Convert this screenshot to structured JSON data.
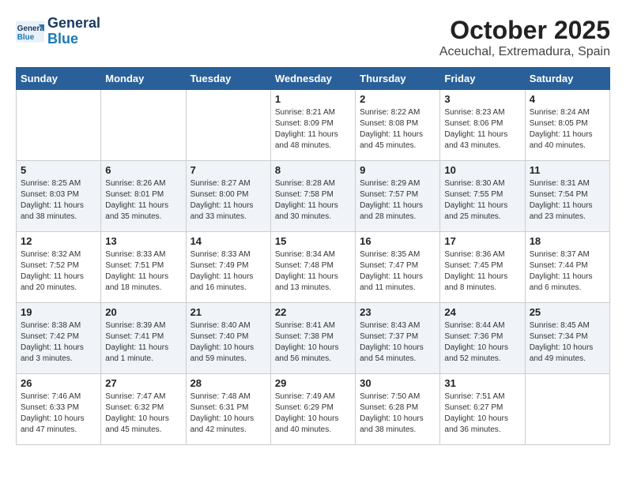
{
  "logo": {
    "line1": "General",
    "line2": "Blue"
  },
  "title": "October 2025",
  "subtitle": "Aceuchal, Extremadura, Spain",
  "headers": [
    "Sunday",
    "Monday",
    "Tuesday",
    "Wednesday",
    "Thursday",
    "Friday",
    "Saturday"
  ],
  "weeks": [
    [
      {
        "day": "",
        "info": ""
      },
      {
        "day": "",
        "info": ""
      },
      {
        "day": "",
        "info": ""
      },
      {
        "day": "1",
        "info": "Sunrise: 8:21 AM\nSunset: 8:09 PM\nDaylight: 11 hours and 48 minutes."
      },
      {
        "day": "2",
        "info": "Sunrise: 8:22 AM\nSunset: 8:08 PM\nDaylight: 11 hours and 45 minutes."
      },
      {
        "day": "3",
        "info": "Sunrise: 8:23 AM\nSunset: 8:06 PM\nDaylight: 11 hours and 43 minutes."
      },
      {
        "day": "4",
        "info": "Sunrise: 8:24 AM\nSunset: 8:05 PM\nDaylight: 11 hours and 40 minutes."
      }
    ],
    [
      {
        "day": "5",
        "info": "Sunrise: 8:25 AM\nSunset: 8:03 PM\nDaylight: 11 hours and 38 minutes."
      },
      {
        "day": "6",
        "info": "Sunrise: 8:26 AM\nSunset: 8:01 PM\nDaylight: 11 hours and 35 minutes."
      },
      {
        "day": "7",
        "info": "Sunrise: 8:27 AM\nSunset: 8:00 PM\nDaylight: 11 hours and 33 minutes."
      },
      {
        "day": "8",
        "info": "Sunrise: 8:28 AM\nSunset: 7:58 PM\nDaylight: 11 hours and 30 minutes."
      },
      {
        "day": "9",
        "info": "Sunrise: 8:29 AM\nSunset: 7:57 PM\nDaylight: 11 hours and 28 minutes."
      },
      {
        "day": "10",
        "info": "Sunrise: 8:30 AM\nSunset: 7:55 PM\nDaylight: 11 hours and 25 minutes."
      },
      {
        "day": "11",
        "info": "Sunrise: 8:31 AM\nSunset: 7:54 PM\nDaylight: 11 hours and 23 minutes."
      }
    ],
    [
      {
        "day": "12",
        "info": "Sunrise: 8:32 AM\nSunset: 7:52 PM\nDaylight: 11 hours and 20 minutes."
      },
      {
        "day": "13",
        "info": "Sunrise: 8:33 AM\nSunset: 7:51 PM\nDaylight: 11 hours and 18 minutes."
      },
      {
        "day": "14",
        "info": "Sunrise: 8:33 AM\nSunset: 7:49 PM\nDaylight: 11 hours and 16 minutes."
      },
      {
        "day": "15",
        "info": "Sunrise: 8:34 AM\nSunset: 7:48 PM\nDaylight: 11 hours and 13 minutes."
      },
      {
        "day": "16",
        "info": "Sunrise: 8:35 AM\nSunset: 7:47 PM\nDaylight: 11 hours and 11 minutes."
      },
      {
        "day": "17",
        "info": "Sunrise: 8:36 AM\nSunset: 7:45 PM\nDaylight: 11 hours and 8 minutes."
      },
      {
        "day": "18",
        "info": "Sunrise: 8:37 AM\nSunset: 7:44 PM\nDaylight: 11 hours and 6 minutes."
      }
    ],
    [
      {
        "day": "19",
        "info": "Sunrise: 8:38 AM\nSunset: 7:42 PM\nDaylight: 11 hours and 3 minutes."
      },
      {
        "day": "20",
        "info": "Sunrise: 8:39 AM\nSunset: 7:41 PM\nDaylight: 11 hours and 1 minute."
      },
      {
        "day": "21",
        "info": "Sunrise: 8:40 AM\nSunset: 7:40 PM\nDaylight: 10 hours and 59 minutes."
      },
      {
        "day": "22",
        "info": "Sunrise: 8:41 AM\nSunset: 7:38 PM\nDaylight: 10 hours and 56 minutes."
      },
      {
        "day": "23",
        "info": "Sunrise: 8:43 AM\nSunset: 7:37 PM\nDaylight: 10 hours and 54 minutes."
      },
      {
        "day": "24",
        "info": "Sunrise: 8:44 AM\nSunset: 7:36 PM\nDaylight: 10 hours and 52 minutes."
      },
      {
        "day": "25",
        "info": "Sunrise: 8:45 AM\nSunset: 7:34 PM\nDaylight: 10 hours and 49 minutes."
      }
    ],
    [
      {
        "day": "26",
        "info": "Sunrise: 7:46 AM\nSunset: 6:33 PM\nDaylight: 10 hours and 47 minutes."
      },
      {
        "day": "27",
        "info": "Sunrise: 7:47 AM\nSunset: 6:32 PM\nDaylight: 10 hours and 45 minutes."
      },
      {
        "day": "28",
        "info": "Sunrise: 7:48 AM\nSunset: 6:31 PM\nDaylight: 10 hours and 42 minutes."
      },
      {
        "day": "29",
        "info": "Sunrise: 7:49 AM\nSunset: 6:29 PM\nDaylight: 10 hours and 40 minutes."
      },
      {
        "day": "30",
        "info": "Sunrise: 7:50 AM\nSunset: 6:28 PM\nDaylight: 10 hours and 38 minutes."
      },
      {
        "day": "31",
        "info": "Sunrise: 7:51 AM\nSunset: 6:27 PM\nDaylight: 10 hours and 36 minutes."
      },
      {
        "day": "",
        "info": ""
      }
    ]
  ]
}
